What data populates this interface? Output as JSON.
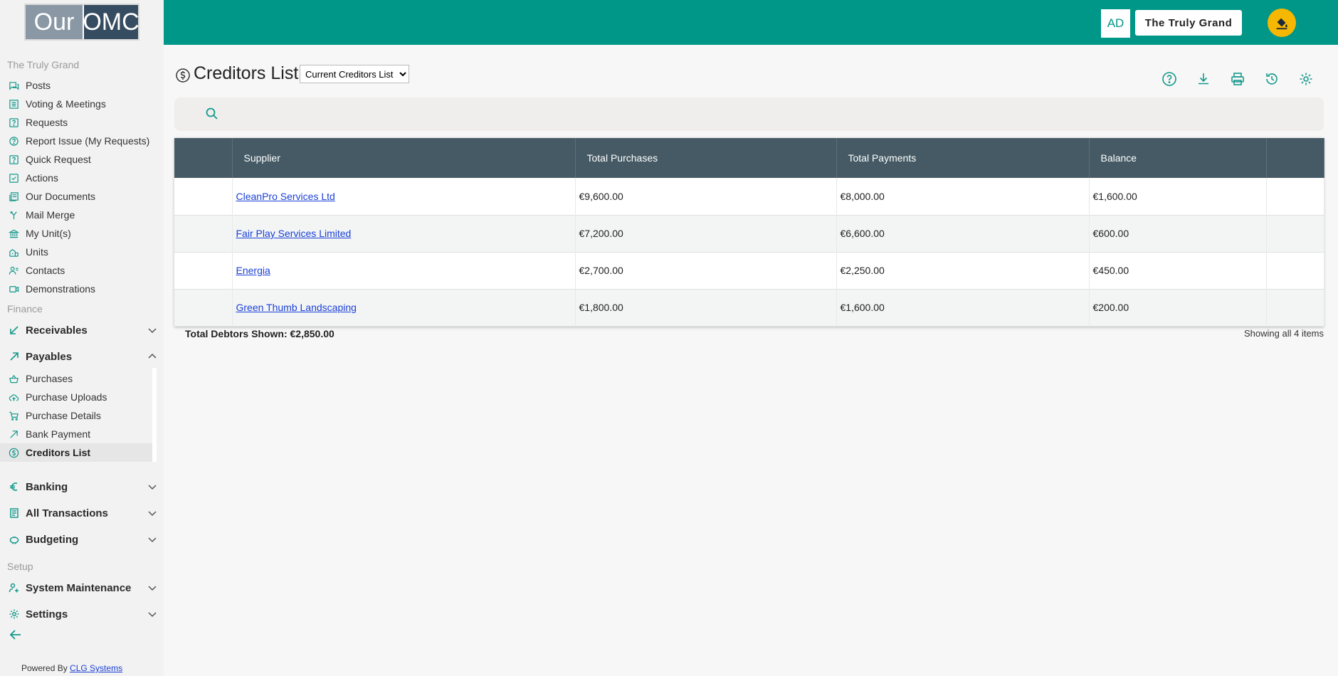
{
  "logo": {
    "part1": "Our",
    "part2": "OMC"
  },
  "sidebar": {
    "section_main": "The Truly Grand",
    "main_items": [
      {
        "label": "Posts",
        "icon": "posts-icon"
      },
      {
        "label": "Voting & Meetings",
        "icon": "list-icon"
      },
      {
        "label": "Requests",
        "icon": "question-square-icon"
      },
      {
        "label": "Report Issue (My Requests)",
        "icon": "question-circle-icon"
      },
      {
        "label": "Quick Request",
        "icon": "question-square-icon"
      },
      {
        "label": "Actions",
        "icon": "checkbox-icon"
      },
      {
        "label": "Our Documents",
        "icon": "documents-icon"
      },
      {
        "label": "Mail Merge",
        "icon": "merge-icon"
      },
      {
        "label": "My Unit(s)",
        "icon": "bank-icon"
      },
      {
        "label": "Units",
        "icon": "buildings-icon"
      },
      {
        "label": "Contacts",
        "icon": "contacts-icon"
      },
      {
        "label": "Demonstrations",
        "icon": "video-icon"
      }
    ],
    "section_finance": "Finance",
    "receivables": "Receivables",
    "payables": "Payables",
    "payables_items": [
      {
        "label": "Purchases",
        "icon": "basket-icon"
      },
      {
        "label": "Purchase Uploads",
        "icon": "cloud-upload-icon"
      },
      {
        "label": "Purchase Details",
        "icon": "cart-icon"
      },
      {
        "label": "Bank Payment",
        "icon": "arrow-up-right-icon"
      },
      {
        "label": "Creditors List",
        "icon": "dollar-circle-icon"
      }
    ],
    "banking": "Banking",
    "all_transactions": "All Transactions",
    "budgeting": "Budgeting",
    "section_setup": "Setup",
    "system_maintenance": "System Maintenance",
    "settings": "Settings"
  },
  "footer": {
    "powered_by": "Powered By",
    "company": "CLG Systems"
  },
  "topbar": {
    "avatar": "AD",
    "org_button": "The Truly Grand"
  },
  "page": {
    "title": "Creditors List",
    "select_value": "Current Creditors List",
    "search_placeholder": ""
  },
  "table": {
    "columns": [
      "",
      "Supplier",
      "Total Purchases",
      "Total Payments",
      "Balance",
      ""
    ],
    "rows": [
      {
        "supplier": "CleanPro Services Ltd",
        "purchases": "€9,600.00",
        "payments": "€8,000.00",
        "balance": "€1,600.00"
      },
      {
        "supplier": "Fair Play Services Limited",
        "purchases": "€7,200.00",
        "payments": "€6,600.00",
        "balance": "€600.00"
      },
      {
        "supplier": "Energia",
        "purchases": "€2,700.00",
        "payments": "€2,250.00",
        "balance": "€450.00"
      },
      {
        "supplier": "Green Thumb Landscaping",
        "purchases": "€1,800.00",
        "payments": "€1,600.00",
        "balance": "€200.00"
      }
    ]
  },
  "summary": {
    "total": "Total Debtors Shown: €2,850.00",
    "showing": "Showing all 4 items"
  },
  "colors": {
    "teal": "#009688",
    "header": "#455a64",
    "accent_yellow": "#f5b700"
  }
}
